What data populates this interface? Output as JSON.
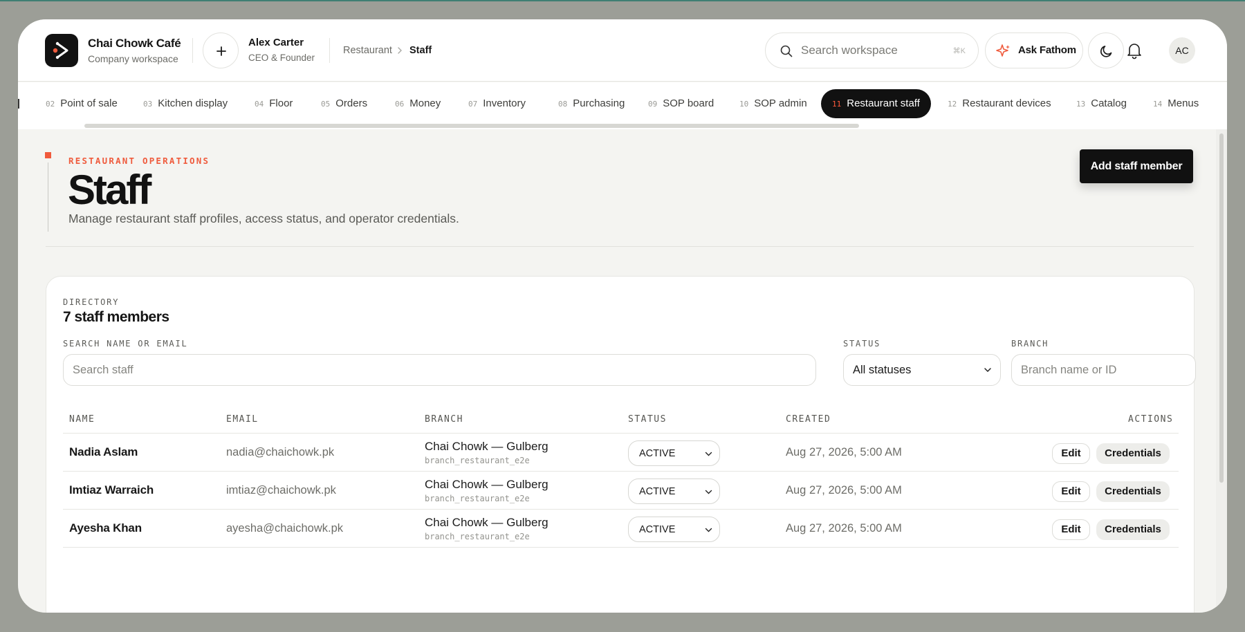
{
  "workspace": {
    "name": "Chai Chowk Café",
    "subtitle": "Company workspace"
  },
  "user": {
    "name": "Alex Carter",
    "role": "CEO & Founder",
    "initials": "AC"
  },
  "breadcrumb": {
    "parent": "Restaurant",
    "current": "Staff"
  },
  "search": {
    "placeholder": "Search workspace",
    "shortcut": "⌘K"
  },
  "ask": {
    "label": "Ask Fathom"
  },
  "nav": {
    "tabs": [
      {
        "num": "02",
        "label": "Point of sale"
      },
      {
        "num": "03",
        "label": "Kitchen display"
      },
      {
        "num": "04",
        "label": "Floor"
      },
      {
        "num": "05",
        "label": "Orders"
      },
      {
        "num": "06",
        "label": "Money"
      },
      {
        "num": "07",
        "label": "Inventory"
      },
      {
        "num": "08",
        "label": "Purchasing"
      },
      {
        "num": "09",
        "label": "SOP board"
      },
      {
        "num": "10",
        "label": "SOP admin"
      },
      {
        "num": "11",
        "label": "Restaurant staff",
        "active": true
      },
      {
        "num": "12",
        "label": "Restaurant devices"
      },
      {
        "num": "13",
        "label": "Catalog"
      },
      {
        "num": "14",
        "label": "Menus"
      }
    ]
  },
  "page": {
    "eyebrow": "RESTAURANT OPERATIONS",
    "title": "Staff",
    "description": "Manage restaurant staff profiles, access status, and operator credentials.",
    "primary_action": "Add staff member"
  },
  "directory": {
    "label": "DIRECTORY",
    "count_title": "7 staff members",
    "filters": {
      "search_label": "SEARCH NAME OR EMAIL",
      "search_placeholder": "Search staff",
      "status_label": "STATUS",
      "status_value": "All statuses",
      "branch_label": "BRANCH",
      "branch_placeholder": "Branch name or ID"
    },
    "columns": [
      "NAME",
      "EMAIL",
      "BRANCH",
      "STATUS",
      "CREATED",
      "ACTIONS"
    ],
    "rows": [
      {
        "name": "Nadia Aslam",
        "email": "nadia@chaichowk.pk",
        "branch": "Chai Chowk — Gulberg",
        "branch_id": "branch_restaurant_e2e",
        "status": "ACTIVE",
        "created": "Aug 27, 2026, 5:00 AM"
      },
      {
        "name": "Imtiaz Warraich",
        "email": "imtiaz@chaichowk.pk",
        "branch": "Chai Chowk — Gulberg",
        "branch_id": "branch_restaurant_e2e",
        "status": "ACTIVE",
        "created": "Aug 27, 2026, 5:00 AM"
      },
      {
        "name": "Ayesha Khan",
        "email": "ayesha@chaichowk.pk",
        "branch": "Chai Chowk — Gulberg",
        "branch_id": "branch_restaurant_e2e",
        "status": "ACTIVE",
        "created": "Aug 27, 2026, 5:00 AM"
      }
    ],
    "row_actions": {
      "edit": "Edit",
      "credentials": "Credentials"
    }
  },
  "colors": {
    "accent": "#ef5b3d",
    "dark": "#111111",
    "background": "#f4f4f1"
  }
}
